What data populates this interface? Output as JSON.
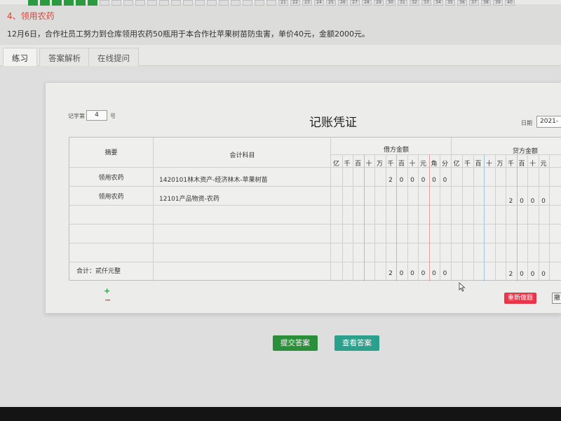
{
  "question_numbers": [
    "",
    "",
    "",
    "",
    "",
    "",
    "",
    "",
    "",
    "",
    "",
    "",
    "",
    "",
    "",
    "",
    "",
    "",
    "",
    "",
    "",
    "21",
    "22",
    "23",
    "24",
    "25",
    "26",
    "27",
    "28",
    "29",
    "30",
    "31",
    "32",
    "33",
    "34",
    "35",
    "36",
    "37",
    "38",
    "39",
    "40"
  ],
  "question": {
    "title": "4、领用农药",
    "text": "12月6日，合作社员工努力到仓库领用农药50瓶用于本合作社苹果树苗防虫害，单价40元，金额2000元。"
  },
  "tabs": [
    "练习",
    "答案解析",
    "在线提问"
  ],
  "voucher": {
    "no_label": "记字第",
    "no_value": "4",
    "no_suffix": "号",
    "title": "记账凭证",
    "date_label": "日期",
    "date_value": "2021-",
    "headers": {
      "summary": "摘要",
      "account": "会计科目",
      "debit": "借方金额",
      "credit": "贷方金额"
    },
    "digit_headers_debit": [
      "亿",
      "千",
      "百",
      "十",
      "万",
      "千",
      "百",
      "十",
      "元",
      "角",
      "分"
    ],
    "digit_headers_credit": [
      "亿",
      "千",
      "百",
      "十",
      "万",
      "千",
      "百",
      "十",
      "元"
    ],
    "rows": [
      {
        "summary": "领用农药",
        "account": "1420101林木资产-经济林木-苹果树苗",
        "debit_digits": [
          "2",
          "0",
          "0",
          "0",
          "0",
          "0"
        ],
        "credit_digits": []
      },
      {
        "summary": "领用农药",
        "account": "12101产品物资-农药",
        "debit_digits": [],
        "credit_digits": [
          "2",
          "0",
          "0",
          "0"
        ]
      }
    ],
    "total_label": "合计：贰仟元整",
    "total_debit_digits": [
      "2",
      "0",
      "0",
      "0",
      "0",
      "0"
    ],
    "total_credit_digits": [
      "2",
      "0",
      "0",
      "0"
    ]
  },
  "buttons": {
    "redo": "重新做题",
    "undo": "撤",
    "submit": "提交答案",
    "view": "查看答案"
  },
  "colors": {
    "accent_green": "#2a8e3a",
    "teal": "#2aa08d",
    "danger_red": "#e8354a",
    "title_red": "#d9433a"
  }
}
